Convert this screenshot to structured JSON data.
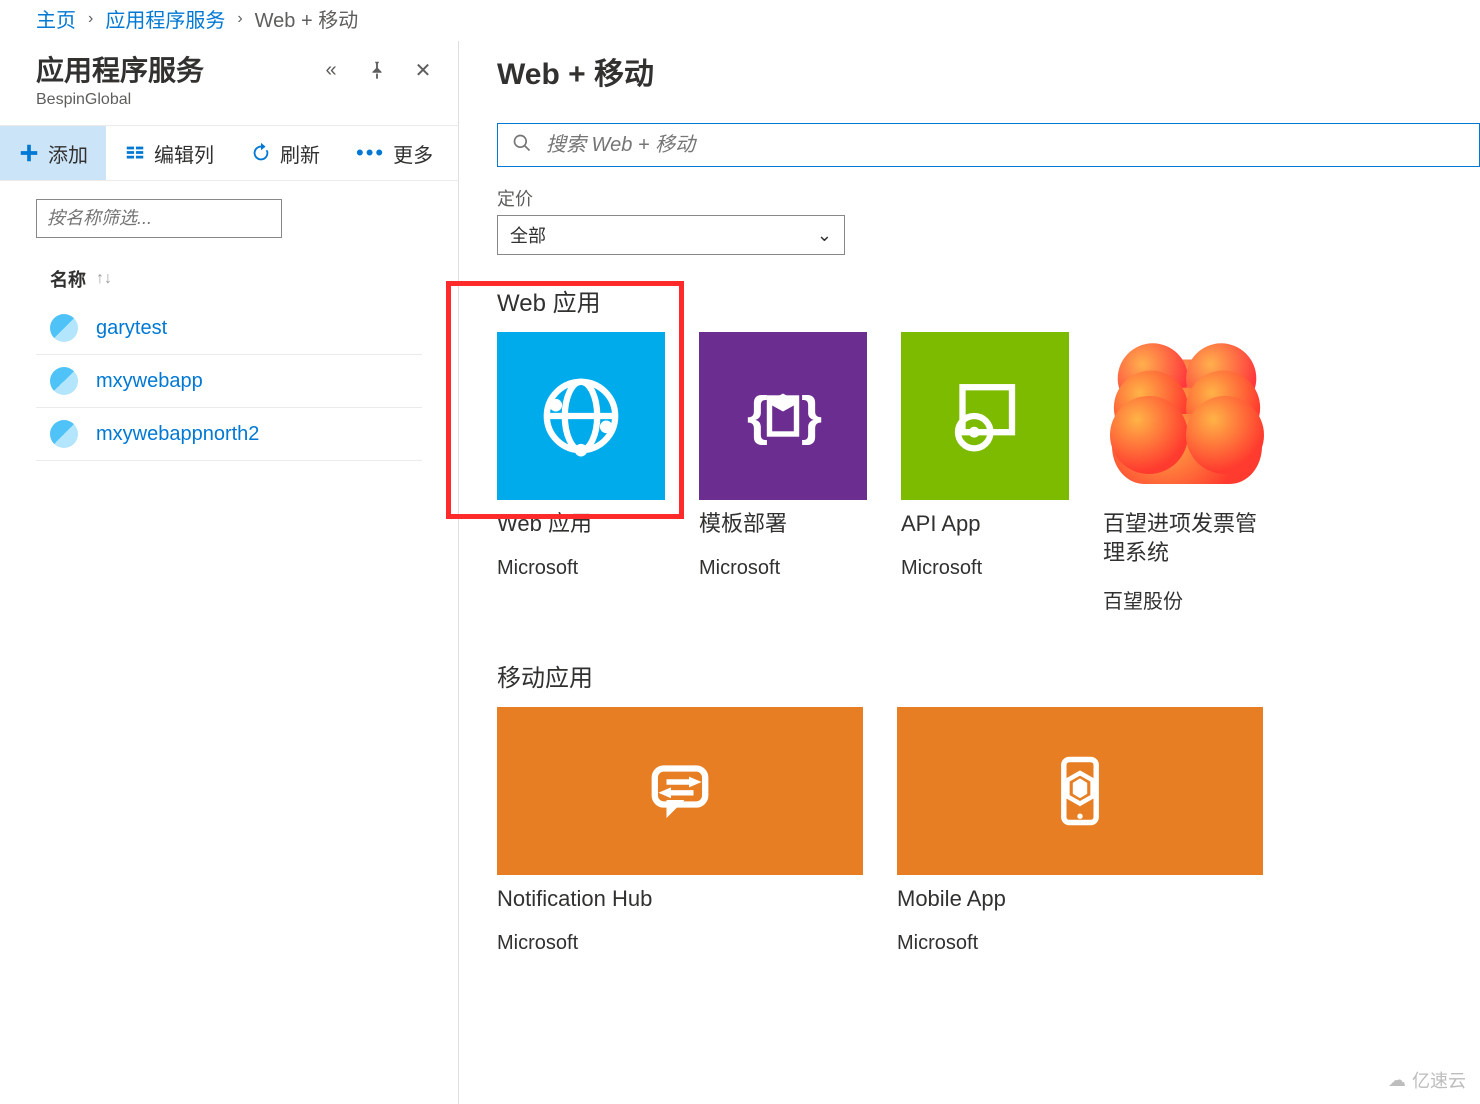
{
  "breadcrumb": {
    "home": "主页",
    "services": "应用程序服务",
    "current": "Web + 移动"
  },
  "leftPanel": {
    "title": "应用程序服务",
    "subtitle": "BespinGlobal",
    "toolbar": {
      "add": "添加",
      "editColumns": "编辑列",
      "refresh": "刷新",
      "more": "更多"
    },
    "filterPlaceholder": "按名称筛选...",
    "columnName": "名称",
    "items": [
      {
        "name": "garytest"
      },
      {
        "name": "mxywebapp"
      },
      {
        "name": "mxywebappnorth2"
      }
    ]
  },
  "rightPanel": {
    "title": "Web + 移动",
    "searchPlaceholder": "搜索 Web + 移动",
    "pricingLabel": "定价",
    "pricingValue": "全部",
    "sections": [
      {
        "title": "Web 应用",
        "cards": [
          {
            "name": "Web 应用",
            "publisher": "Microsoft",
            "icon": "web",
            "bg": "bg-blue"
          },
          {
            "name": "模板部署",
            "publisher": "Microsoft",
            "icon": "template",
            "bg": "bg-purple"
          },
          {
            "name": "API App",
            "publisher": "Microsoft",
            "icon": "api",
            "bg": "bg-green"
          },
          {
            "name": "百望进项发票管理系统",
            "publisher": "百望股份",
            "icon": "baiwang",
            "bg": ""
          }
        ]
      },
      {
        "title": "移动应用",
        "cards": [
          {
            "name": "Notification Hub",
            "publisher": "Microsoft",
            "icon": "notification",
            "bg": "bg-orange",
            "wide": true
          },
          {
            "name": "Mobile App",
            "publisher": "Microsoft",
            "icon": "mobile",
            "bg": "bg-orange",
            "wide": true
          }
        ]
      }
    ]
  },
  "watermark": "亿速云"
}
